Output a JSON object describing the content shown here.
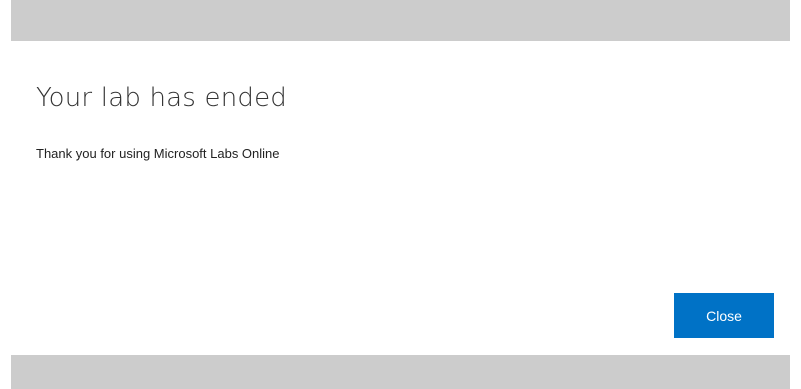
{
  "dialog": {
    "title": "Your lab has ended",
    "message": "Thank you for using Microsoft Labs Online",
    "close_label": "Close"
  },
  "colors": {
    "overlay_band": "#cccccc",
    "dialog_background": "#ffffff",
    "primary_button": "#0072c6",
    "title_text": "#333333"
  }
}
